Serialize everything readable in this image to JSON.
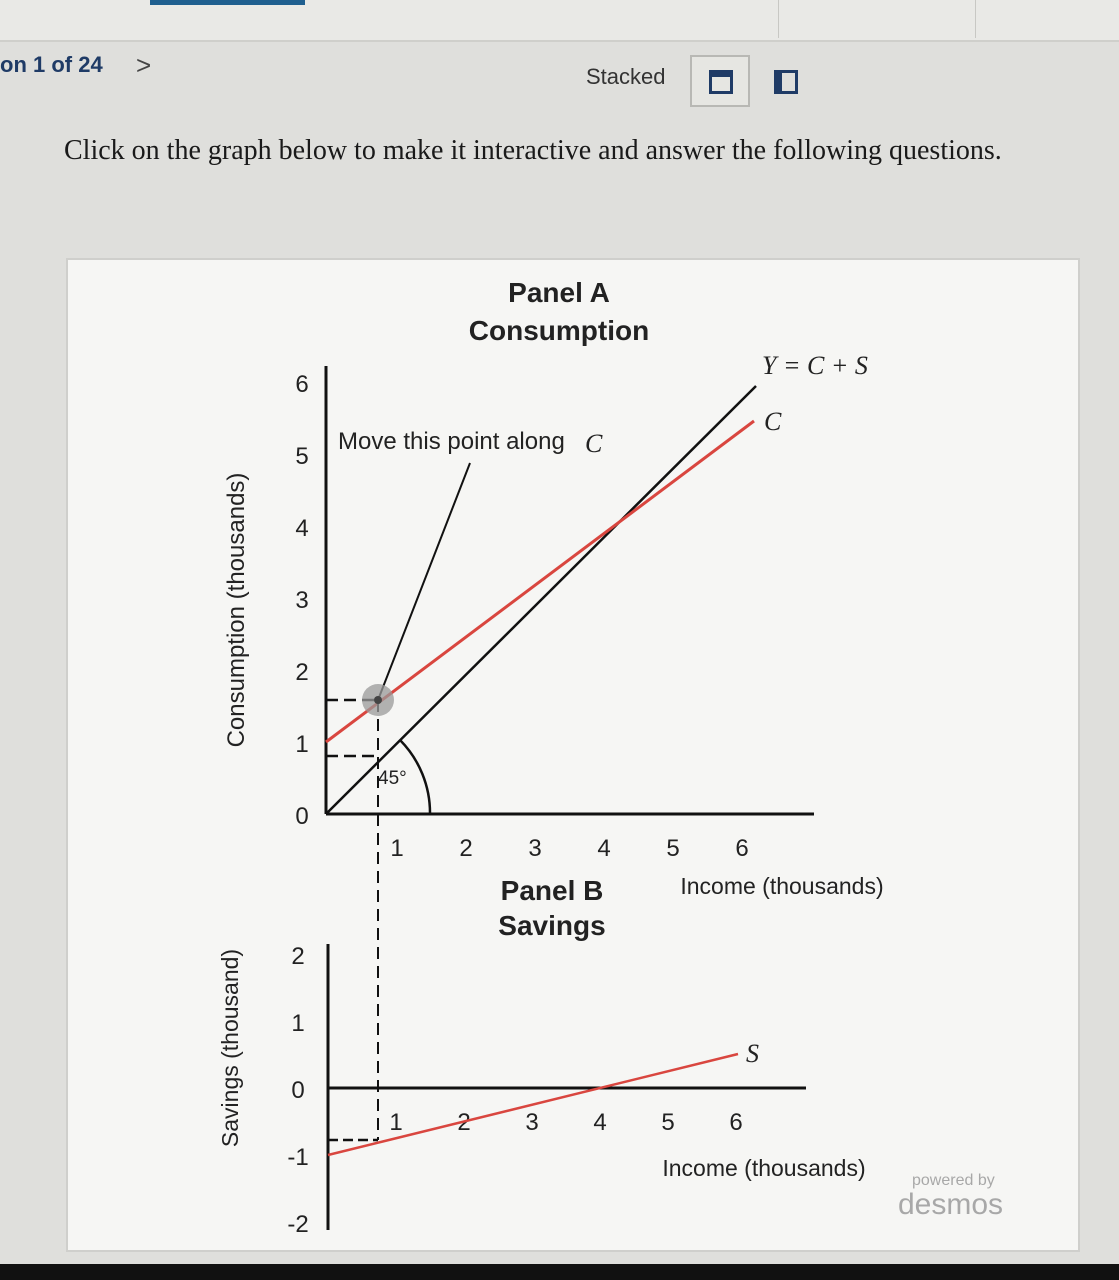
{
  "nav": {
    "question_counter": "on 1 of 24",
    "next_glyph": ">"
  },
  "view": {
    "label": "Stacked",
    "stacked_icon": "stacked-layout-icon",
    "single_icon": "single-layout-icon"
  },
  "instructions": "Click on the graph below to make it interactive and answer the following questions.",
  "chart_data": [
    {
      "type": "line",
      "title": "Panel A",
      "subtitle": "Consumption",
      "xlabel": "Income (thousands)",
      "ylabel": "Consumption (thousands)",
      "x_ticks": [
        "1",
        "2",
        "3",
        "4",
        "5",
        "6"
      ],
      "y_ticks": [
        "0",
        "1",
        "2",
        "3",
        "4",
        "5",
        "6"
      ],
      "xlim": [
        0,
        7
      ],
      "ylim": [
        0,
        6
      ],
      "series": [
        {
          "name": "Y = C + S",
          "color": "#111111",
          "points": [
            [
              0,
              0
            ],
            [
              6,
              6
            ]
          ]
        },
        {
          "name": "C",
          "color": "#d9463f",
          "points": [
            [
              0,
              1
            ],
            [
              6,
              5.5
            ]
          ]
        }
      ],
      "point": {
        "x": 0.75,
        "y": 1.56
      },
      "annotations": [
        "Move this point along",
        "C",
        "45°"
      ]
    },
    {
      "type": "line",
      "title": "Panel B",
      "subtitle": "Savings",
      "xlabel": "Income (thousands)",
      "ylabel": "Savings (thousand)",
      "x_ticks": [
        "1",
        "2",
        "3",
        "4",
        "5",
        "6"
      ],
      "y_ticks": [
        "2",
        "1",
        "0",
        "-1",
        "-2"
      ],
      "xlim": [
        0,
        7
      ],
      "ylim": [
        -2,
        2
      ],
      "series": [
        {
          "name": "S",
          "color": "#d9463f",
          "points": [
            [
              0,
              -1
            ],
            [
              6,
              0.5
            ]
          ]
        }
      ]
    }
  ],
  "watermark": {
    "powered": "powered by",
    "brand": "desmos"
  }
}
